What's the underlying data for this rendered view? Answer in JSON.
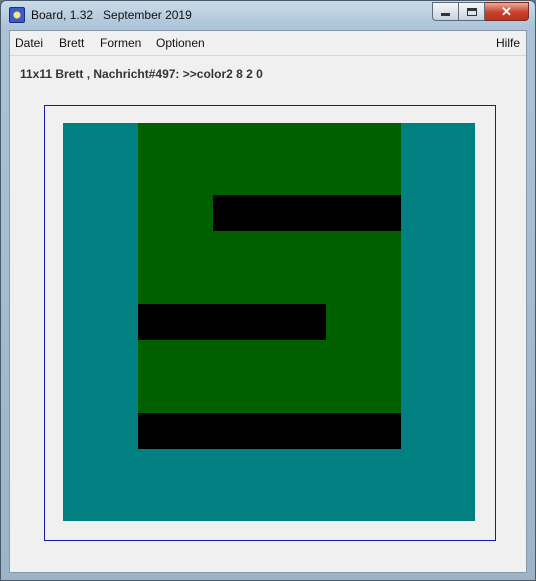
{
  "window": {
    "title": "Board, 1.32   September 2019",
    "minimize_icon": "minimize-icon",
    "maximize_icon": "maximize-icon",
    "close_icon": "close-icon",
    "close_glyph": "✕"
  },
  "menu": {
    "items": [
      "Datei",
      "Brett",
      "Formen",
      "Optionen"
    ],
    "help": "Hilfe"
  },
  "status": {
    "text": "11x11 Brett , Nachricht#497: >>color2 8 2 0"
  },
  "board": {
    "size": 11,
    "colors": {
      "teal": "#008080",
      "green": "#006000",
      "black": "#000000"
    }
  }
}
